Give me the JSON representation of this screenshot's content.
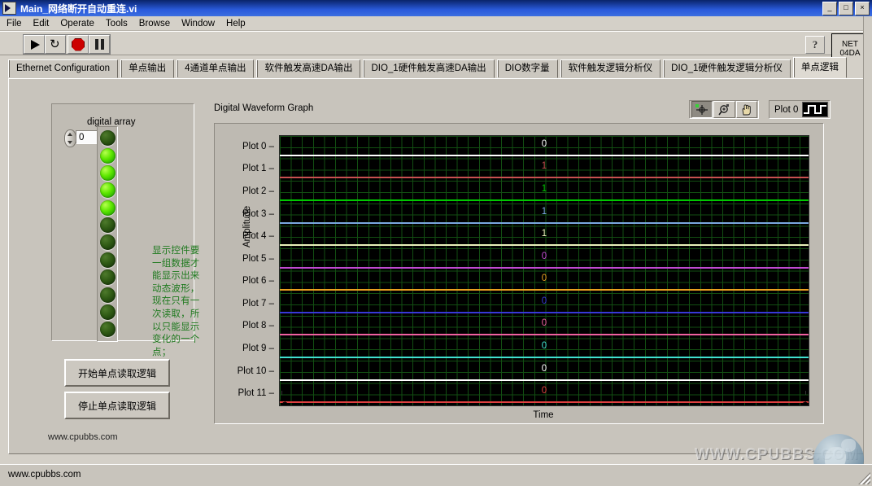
{
  "window": {
    "title": "Main_网络断开自动重连.vi",
    "icon": "labview-vi-icon",
    "buttons": {
      "minimize": "_",
      "maximize": "□",
      "close": "×"
    }
  },
  "menubar": {
    "items": [
      "File",
      "Edit",
      "Operate",
      "Tools",
      "Browse",
      "Window",
      "Help"
    ]
  },
  "toolbar": {
    "run": "run-arrow-icon",
    "run_continuously": "run-continuously-icon",
    "abort": "abort-execution-icon",
    "pause": "pause-icon",
    "help": "?",
    "net_badge": {
      "line1": "NET",
      "line2": "04DA"
    }
  },
  "tabs": {
    "items": [
      "Ethernet Configuration",
      "单点输出",
      "4通道单点输出",
      "软件触发高速DA输出",
      "DIO_1硬件触发高速DA输出",
      "DIO数字量",
      "软件触发逻辑分析仪",
      "DIO_1硬件触发逻辑分析仪",
      "单点逻辑"
    ],
    "selected_index": 8
  },
  "controls": {
    "array_label": "digital array",
    "index_value": "0",
    "leds": [
      0,
      1,
      1,
      1,
      1,
      0,
      0,
      0,
      0,
      0,
      0,
      0
    ],
    "note": "显示控件要一组数据才能显示出来动态波形，现在只有一次读取，所以只能显示变化的一个点；",
    "start_button": "开始单点读取逻辑",
    "stop_button": "停止单点读取逻辑",
    "site_label": "www.cpubbs.com"
  },
  "graph": {
    "title": "Digital Waveform Graph",
    "palette": {
      "cursor_move": "cursor-move-icon",
      "zoom": "zoom-icon",
      "pan": "pan-hand-icon"
    },
    "legend": {
      "name": "Plot 0",
      "swatch": "digital-waveform-icon"
    }
  },
  "chart_data": {
    "type": "line",
    "title": "Digital Waveform Graph",
    "xlabel": "Time",
    "ylabel": "Amplitude",
    "xlim": [
      -1,
      1
    ],
    "xticks": [
      "-1",
      "1"
    ],
    "grid": true,
    "background": "#000000",
    "gridcolor": "#124e12",
    "categories": [
      "Plot 0",
      "Plot 1",
      "Plot 2",
      "Plot 3",
      "Plot 4",
      "Plot 5",
      "Plot 6",
      "Plot 7",
      "Plot 8",
      "Plot 9",
      "Plot 10",
      "Plot 11"
    ],
    "values": [
      0,
      1,
      1,
      1,
      1,
      0,
      0,
      0,
      0,
      0,
      0,
      0
    ],
    "series": [
      {
        "name": "Plot 0",
        "value": "0",
        "color": "#ffffff"
      },
      {
        "name": "Plot 1",
        "value": "1",
        "color": "#c85050"
      },
      {
        "name": "Plot 2",
        "value": "1",
        "color": "#00c800"
      },
      {
        "name": "Plot 3",
        "value": "1",
        "color": "#7aa7e0"
      },
      {
        "name": "Plot 4",
        "value": "1",
        "color": "#e8f0b8"
      },
      {
        "name": "Plot 5",
        "value": "0",
        "color": "#c24ad2"
      },
      {
        "name": "Plot 6",
        "value": "0",
        "color": "#e8a020"
      },
      {
        "name": "Plot 7",
        "value": "0",
        "color": "#3838d8"
      },
      {
        "name": "Plot 8",
        "value": "0",
        "color": "#f060a0"
      },
      {
        "name": "Plot 9",
        "value": "0",
        "color": "#40e0d0"
      },
      {
        "name": "Plot 10",
        "value": "0",
        "color": "#ffffff"
      },
      {
        "name": "Plot 11",
        "value": "0",
        "color": "#e04040"
      }
    ]
  },
  "watermark": {
    "text": "WWW.CPUBBS.COM",
    "globe": "globe-icon"
  },
  "statusbar": {
    "text": "www.cpubbs.com"
  }
}
